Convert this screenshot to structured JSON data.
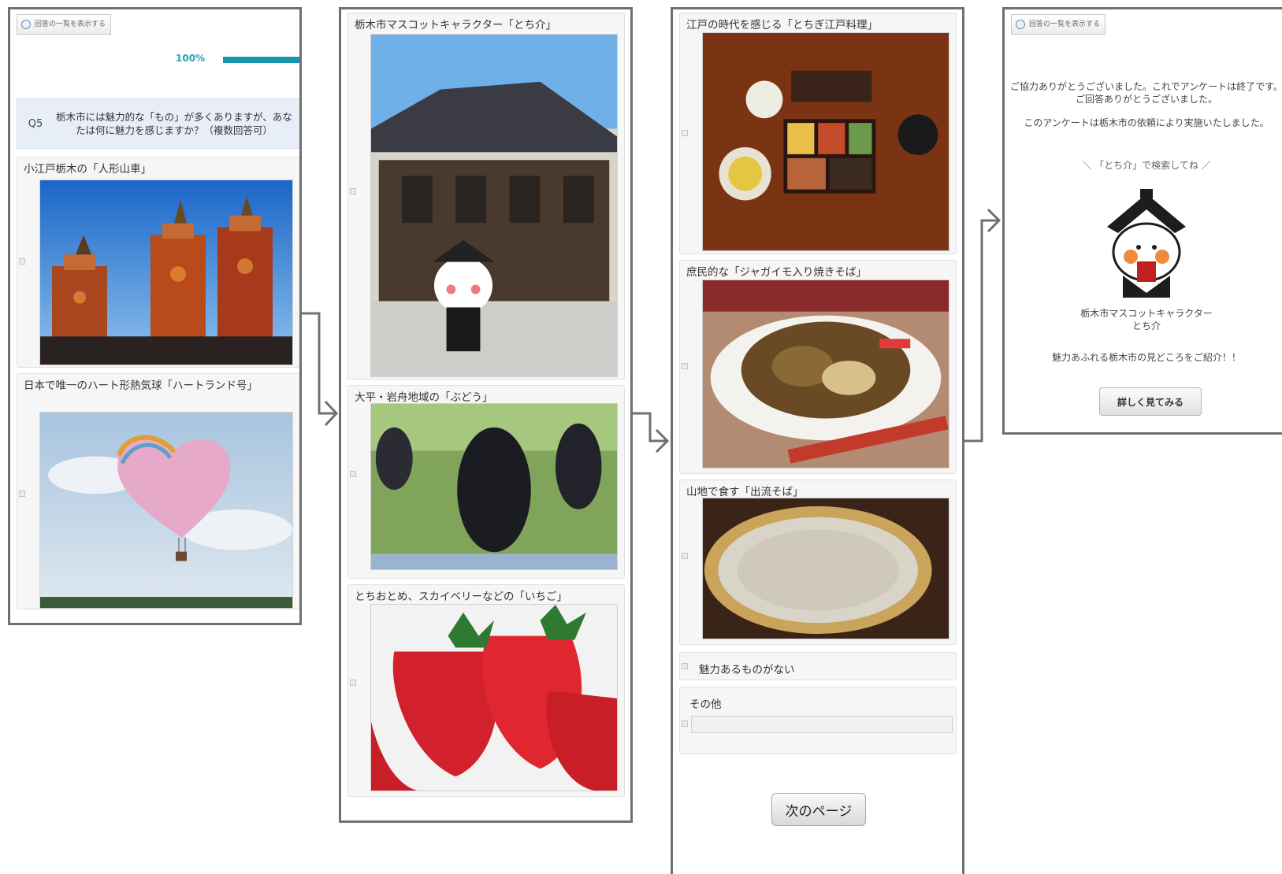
{
  "common": {
    "toplink_label": "回答の一覧を表示する"
  },
  "panel1": {
    "progress": {
      "label": "100%",
      "value": 1.0
    },
    "question": {
      "number": "Q5",
      "text": "栃木市には魅力的な「もの」が多くありますが、あなたは何に魅力を感じますか？（複数回答可）"
    },
    "items": [
      {
        "label": "小江戸栃木の「人形山車」"
      },
      {
        "label": "日本で唯一のハート形熱気球「ハートランド号」"
      }
    ]
  },
  "panel2": {
    "items": [
      {
        "label": "栃木市マスコットキャラクター「とち介」"
      },
      {
        "label": "大平・岩舟地域の「ぶどう」"
      },
      {
        "label": "とちおとめ、スカイベリーなどの「いちご」"
      }
    ]
  },
  "panel3": {
    "items": [
      {
        "label": "江戸の時代を感じる「とちぎ江戸料理」"
      },
      {
        "label": "庶民的な「ジャガイモ入り焼きそば」"
      },
      {
        "label": "山地で食す「出流そば」"
      }
    ],
    "no_attraction_label": "魅力あるものがない",
    "other_label": "その他",
    "other_input_value": "",
    "next_button_label": "次のページ"
  },
  "panel4": {
    "thanks_message": "ご協力ありがとうございました。これでアンケートは終了です。ご回答ありがとうございました。",
    "request_message": "このアンケートは栃木市の依頼により実施いたしました。",
    "search_hint": "「とち介」で検索してね",
    "mascot_caption_line1": "栃木市マスコットキャラクター",
    "mascot_caption_line2": "とち介",
    "intro_text": "魅力あふれる栃木市の見どころをご紹介！！",
    "more_button_label": "詳しく見てみる"
  },
  "colors": {
    "panel_border": "#707070",
    "accent": "#1995ad",
    "question_bg": "#e7eef8"
  }
}
